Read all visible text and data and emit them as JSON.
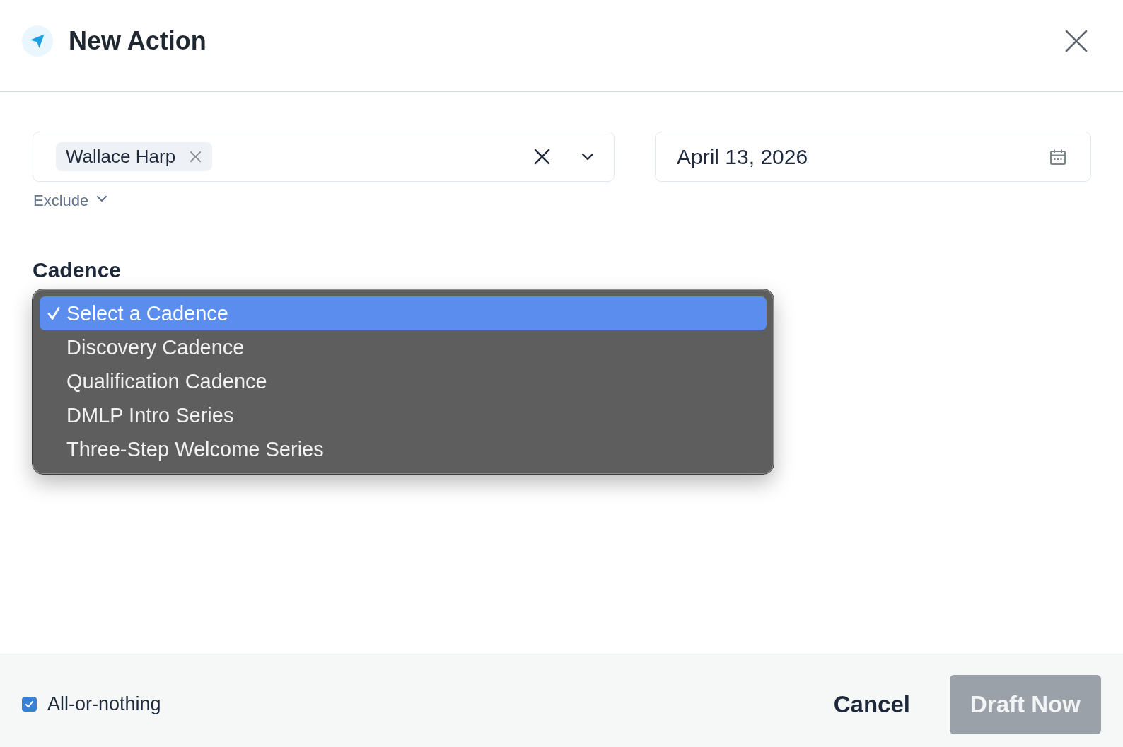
{
  "header": {
    "title": "New Action"
  },
  "recipients": {
    "chips": [
      {
        "label": "Wallace Harp"
      }
    ]
  },
  "exclude": {
    "label": "Exclude"
  },
  "date": {
    "value": "April 13, 2026"
  },
  "cadence": {
    "label": "Cadence",
    "options": [
      {
        "label": "Select a Cadence",
        "selected": true
      },
      {
        "label": "Discovery Cadence",
        "selected": false
      },
      {
        "label": "Qualification Cadence",
        "selected": false
      },
      {
        "label": "DMLP Intro Series",
        "selected": false
      },
      {
        "label": "Three-Step Welcome Series",
        "selected": false
      }
    ]
  },
  "footer": {
    "all_or_nothing": {
      "label": "All-or-nothing",
      "checked": true
    },
    "buttons": [
      {
        "label": "Cancel",
        "kind": "text",
        "disabled": false
      },
      {
        "label": "Draft Now",
        "kind": "primary",
        "disabled": true
      }
    ]
  }
}
